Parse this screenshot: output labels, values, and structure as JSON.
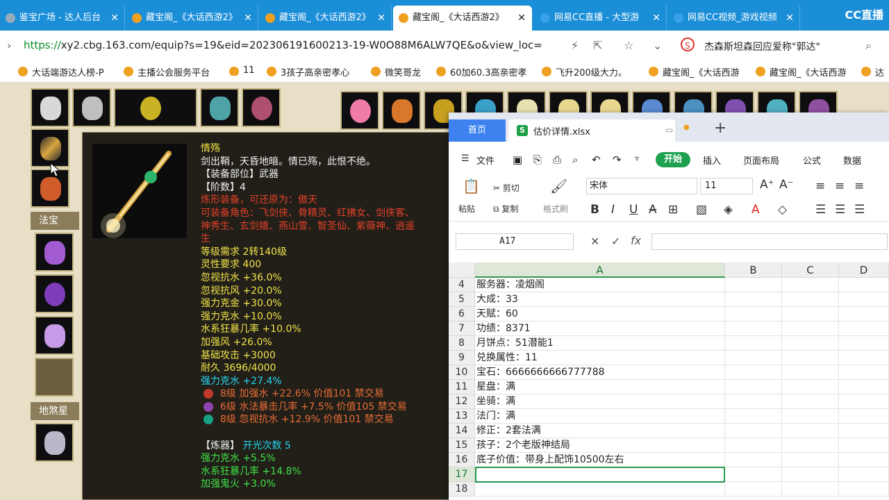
{
  "browser": {
    "tabs": [
      {
        "label": "鉴宝广场 - 达人后台",
        "icon": "globe-icon",
        "active": false
      },
      {
        "label": "藏宝阁_《大话西游2》",
        "icon": "cbg-icon",
        "active": false
      },
      {
        "label": "藏宝阁_《大话西游2》",
        "icon": "cbg-icon",
        "active": false
      },
      {
        "label": "藏宝阁_《大话西游2》",
        "icon": "cbg-icon",
        "active": true
      },
      {
        "label": "网易CC直播 - 大型游",
        "icon": "cc-icon",
        "active": false
      },
      {
        "label": "网易CC视频_游戏视频",
        "icon": "cc-icon",
        "active": false
      }
    ],
    "logo": "CC直播",
    "url_scheme": "https://",
    "url_rest": "xy2.cbg.163.com/equip?s=19&eid=202306191600213-19-W0O88M6ALW7QE&o&view_loc=",
    "news_text": "杰森斯坦森回应爱称\"郭达\"",
    "bookmarks": [
      "大话端游达人榜-P",
      "主播公会服务平台",
      "11",
      "3孩子高亲密孝心",
      "微笑哥龙",
      "60加60.3高亲密孝",
      "飞升200级大力。",
      "藏宝阁_《大话西游",
      "藏宝阁_《大话西游",
      "达"
    ]
  },
  "game": {
    "section_fabao": "法宝",
    "section_disha": "地煞星",
    "tooltip": {
      "lines": [
        {
          "text": "情殇",
          "color": "yellow"
        },
        {
          "text": "剑出鞘，天昏地暗。情已殇，此恨不绝。",
          "color": "white"
        },
        {
          "text": "【装备部位】武器",
          "color": "white"
        },
        {
          "text": "【阶数】4",
          "color": "white"
        },
        {
          "text": "炼形装备，可还原为：傲天",
          "color": "red"
        },
        {
          "text": "可装备角色：飞剑侠、骨精灵、红拂女、剑侠客、",
          "color": "red"
        },
        {
          "text": "神秀生、玄剑娥、燕山雪、智圣仙、紫薇神、逍遥",
          "color": "red"
        },
        {
          "text": "生",
          "color": "red"
        },
        {
          "text": "等级需求 2转140级",
          "color": "yellow"
        },
        {
          "text": "灵性要求 400",
          "color": "yellow"
        },
        {
          "text": "忽视抗水 +36.0%",
          "color": "yellow"
        },
        {
          "text": "忽视抗风 +20.0%",
          "color": "yellow"
        },
        {
          "text": "强力克金 +30.0%",
          "color": "yellow"
        },
        {
          "text": "强力克水 +10.0%",
          "color": "yellow"
        },
        {
          "text": "水系狂暴几率 +10.0%",
          "color": "yellow"
        },
        {
          "text": "加强风 +26.0%",
          "color": "yellow"
        },
        {
          "text": "基础攻击 +3000",
          "color": "yellow"
        },
        {
          "text": "耐久 3696/4000",
          "color": "yellow"
        },
        {
          "text": "强力克水 +27.4%",
          "color": "cyan"
        },
        {
          "text": "8级 加强水 +22.6% 价值101 禁交易",
          "color": "orange",
          "gem": "#c0392b"
        },
        {
          "text": "6级 水法暴击几率 +7.5% 价值105 禁交易",
          "color": "orange",
          "gem": "#8e44ad"
        },
        {
          "text": "8级 忽视抗水 +12.9% 价值101 禁交易",
          "color": "orange",
          "gem": "#16a085"
        },
        {
          "text": "",
          "color": "white"
        },
        {
          "text": "【炼器】",
          "color": "white",
          "suffix": "开光次数 5",
          "suffix_color": "cyan"
        },
        {
          "text": "强力克水 +5.5%",
          "color": "green"
        },
        {
          "text": "水系狂暴几率 +14.8%",
          "color": "green"
        },
        {
          "text": "加强鬼火 +3.0%",
          "color": "green"
        }
      ]
    }
  },
  "wps": {
    "home_tab": "首页",
    "file_tab": "估价详情.xlsx",
    "menu": {
      "file": "文件",
      "start": "开始",
      "insert": "插入",
      "layout": "页面布局",
      "formula": "公式",
      "data": "数据"
    },
    "ribbon": {
      "paste": "粘贴",
      "cut": "剪切",
      "copy": "复制",
      "format_painter": "格式刷",
      "font_name": "宋体",
      "font_size": "11"
    },
    "name_box": "A17",
    "columns": [
      "A",
      "B",
      "C",
      "D"
    ],
    "rows": [
      {
        "num": "4",
        "a": "服务器：凌烟阁"
      },
      {
        "num": "5",
        "a": "大成：33"
      },
      {
        "num": "6",
        "a": "天赋：60"
      },
      {
        "num": "7",
        "a": "功绩：8371"
      },
      {
        "num": "8",
        "a": "月饼点：51潜能1"
      },
      {
        "num": "9",
        "a": "兑换属性：11"
      },
      {
        "num": "10",
        "a": "宝石：6666666666777788"
      },
      {
        "num": "11",
        "a": "星盘：满"
      },
      {
        "num": "12",
        "a": "坐骑：满"
      },
      {
        "num": "13",
        "a": "法门：满"
      },
      {
        "num": "14",
        "a": "修正：2套法满"
      },
      {
        "num": "15",
        "a": "孩子：2个老版神结局"
      },
      {
        "num": "16",
        "a": "底子价值：带身上配饰10500左右"
      },
      {
        "num": "17",
        "a": ""
      },
      {
        "num": "18",
        "a": ""
      }
    ]
  }
}
